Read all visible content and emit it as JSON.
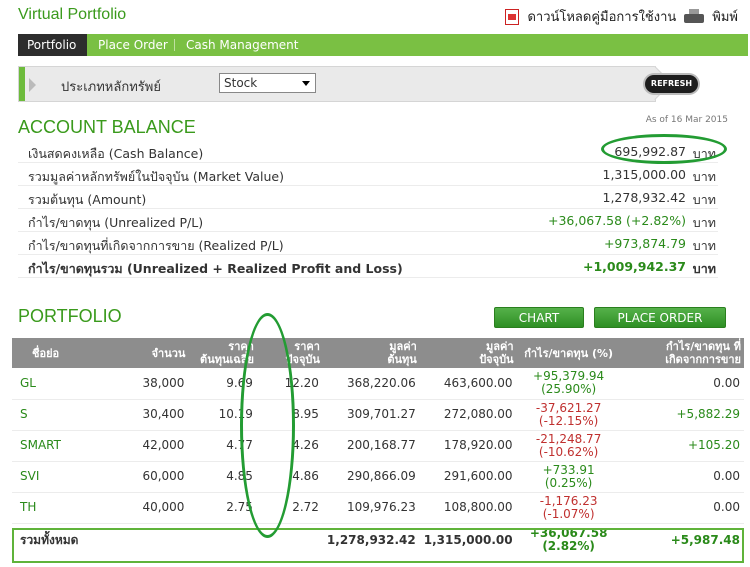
{
  "header": {
    "title": "Virtual Portfolio",
    "download_label": "ดาวน์โหลดคู่มือการใช้งาน",
    "print_label": "พิมพ์"
  },
  "tabs": [
    {
      "label": "Portfolio",
      "active": true
    },
    {
      "label": "Place Order",
      "active": false
    },
    {
      "label": "Cash Management",
      "active": false
    }
  ],
  "filter": {
    "label": "ประเภทหลักทรัพย์",
    "selected": "Stock"
  },
  "refresh_label": "REFRESH",
  "account": {
    "title": "ACCOUNT BALANCE",
    "as_of": "As of 16 Mar 2015",
    "unit": "บาท",
    "rows": [
      {
        "label": "เงินสดคงเหลือ (Cash Balance)",
        "value": "695,992.87"
      },
      {
        "label": "รวมมูลค่าหลักทรัพย์ในปัจจุบัน (Market Value)",
        "value": "1,315,000.00"
      },
      {
        "label": "รวมต้นทุน (Amount)",
        "value": "1,278,932.42"
      },
      {
        "label": "กำไร/ขาดทุน (Unrealized P/L)",
        "value": "+36,067.58 (+2.82%)"
      },
      {
        "label": "กำไร/ขาดทุนที่เกิดจากการขาย (Realized P/L)",
        "value": "+973,874.79"
      },
      {
        "label": "กำไร/ขาดทุนรวม (Unrealized + Realized Profit and Loss)",
        "value": "+1,009,942.37"
      }
    ]
  },
  "portfolio": {
    "title": "PORTFOLIO",
    "chart_btn": "CHART",
    "place_order_btn": "PLACE ORDER",
    "headers": {
      "symbol": "ชื่อย่อ",
      "volume": "จำนวน",
      "avg_cost_1": "ราคา",
      "avg_cost_2": "ต้นทุนเฉลี่ย",
      "price_1": "ราคา",
      "price_2": "ปัจจุบัน",
      "cost_value_1": "มูลค่า",
      "cost_value_2": "ต้นทุน",
      "market_value_1": "มูลค่า",
      "market_value_2": "ปัจจุบัน",
      "unrealized": "กำไร/ขาดทุน (%)",
      "realized_1": "กำไร/ขาดทุน ที่",
      "realized_2": "เกิดจากการขาย"
    },
    "rows": [
      {
        "symbol": "GL",
        "volume": "38,000",
        "avg_cost": "9.69",
        "price": "12.20",
        "cost_value": "368,220.06",
        "market_value": "463,600.00",
        "pl": "+95,379.94",
        "pl_pct": "(25.90%)",
        "realized": "0.00"
      },
      {
        "symbol": "S",
        "volume": "30,400",
        "avg_cost": "10.19",
        "price": "8.95",
        "cost_value": "309,701.27",
        "market_value": "272,080.00",
        "pl": "-37,621.27",
        "pl_pct": "(-12.15%)",
        "realized": "+5,882.29"
      },
      {
        "symbol": "SMART",
        "volume": "42,000",
        "avg_cost": "4.77",
        "price": "4.26",
        "cost_value": "200,168.77",
        "market_value": "178,920.00",
        "pl": "-21,248.77",
        "pl_pct": "(-10.62%)",
        "realized": "+105.20"
      },
      {
        "symbol": "SVI",
        "volume": "60,000",
        "avg_cost": "4.85",
        "price": "4.86",
        "cost_value": "290,866.09",
        "market_value": "291,600.00",
        "pl": "+733.91",
        "pl_pct": "(0.25%)",
        "realized": "0.00"
      },
      {
        "symbol": "TH",
        "volume": "40,000",
        "avg_cost": "2.75",
        "price": "2.72",
        "cost_value": "109,976.23",
        "market_value": "108,800.00",
        "pl": "-1,176.23",
        "pl_pct": "(-1.07%)",
        "realized": "0.00"
      }
    ],
    "total": {
      "label": "รวมทั้งหมด",
      "cost_value": "1,278,932.42",
      "market_value": "1,315,000.00",
      "pl": "+36,067.58",
      "pl_pct": "(2.82%)",
      "realized": "+5,987.48"
    }
  },
  "colors": {
    "brand_green": "#3a9a1c",
    "tab_green": "#7ac043",
    "loss_red": "#c0302f",
    "annotation_green": "#239c33"
  }
}
